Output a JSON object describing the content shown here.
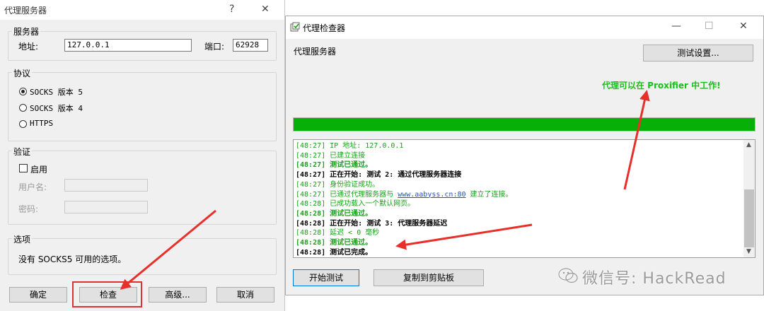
{
  "left_dialog": {
    "title": "代理服务器",
    "help_glyph": "?",
    "close_glyph": "✕",
    "server_group": "服务器",
    "address_label": "地址:",
    "address_value": "127.0.0.1",
    "port_label": "端口:",
    "port_value": "62928",
    "protocol_group": "协议",
    "protocols": [
      "SOCKS 版本 5",
      "SOCKS 版本 4",
      "HTTPS"
    ],
    "selected_protocol": "SOCKS 版本 5",
    "auth_group": "验证",
    "enable_label": "启用",
    "username_label": "用户名:",
    "password_label": "密码:",
    "options_group": "选项",
    "options_text": "没有 SOCKS5 可用的选项。",
    "buttons": {
      "ok": "确定",
      "check": "检查",
      "advanced": "高级...",
      "cancel": "取消"
    }
  },
  "right_dialog": {
    "title": "代理检查器",
    "min_glyph": "—",
    "max_glyph": "☐",
    "close_glyph": "✕",
    "proxy_label": "代理服务器",
    "settings_button": "测试设置...",
    "result_message": "代理可以在 Proxifier 中工作!",
    "progress": 1.0,
    "log": [
      {
        "style": "g",
        "text": "[48:27] IP 地址: 127.0.0.1"
      },
      {
        "style": "g",
        "text": "[48:27] 已建立连接"
      },
      {
        "style": "gb",
        "text": "[48:27] 测试已通过。"
      },
      {
        "style": "kb",
        "text": "[48:27] 正在开始: 测试 2: 通过代理服务器连接"
      },
      {
        "style": "g",
        "text": "[48:27] 身份验证成功。"
      },
      {
        "style": "g",
        "pre": "[48:27] 已通过代理服务器与 ",
        "link": "www.aabyss.cn:80",
        "post": " 建立了连接。"
      },
      {
        "style": "g",
        "text": "[48:28] 已成功载入一个默认网页。"
      },
      {
        "style": "gb",
        "text": "[48:28] 测试已通过。"
      },
      {
        "style": "kb",
        "text": "[48:28] 正在开始: 测试 3: 代理服务器延迟"
      },
      {
        "style": "g",
        "text": "[48:28] 延迟 < 0 毫秒"
      },
      {
        "style": "gb",
        "text": "[48:28] 测试已通过。"
      },
      {
        "style": "kb",
        "text": "[48:28] 测试已完成。"
      }
    ],
    "buttons": {
      "start": "开始测试",
      "copy": "复制到剪贴板"
    }
  },
  "watermark": "微信号: HackRead",
  "colors": {
    "progress_green": "#06b006",
    "success_green": "#18c018",
    "arrow_red": "#e8302a"
  }
}
